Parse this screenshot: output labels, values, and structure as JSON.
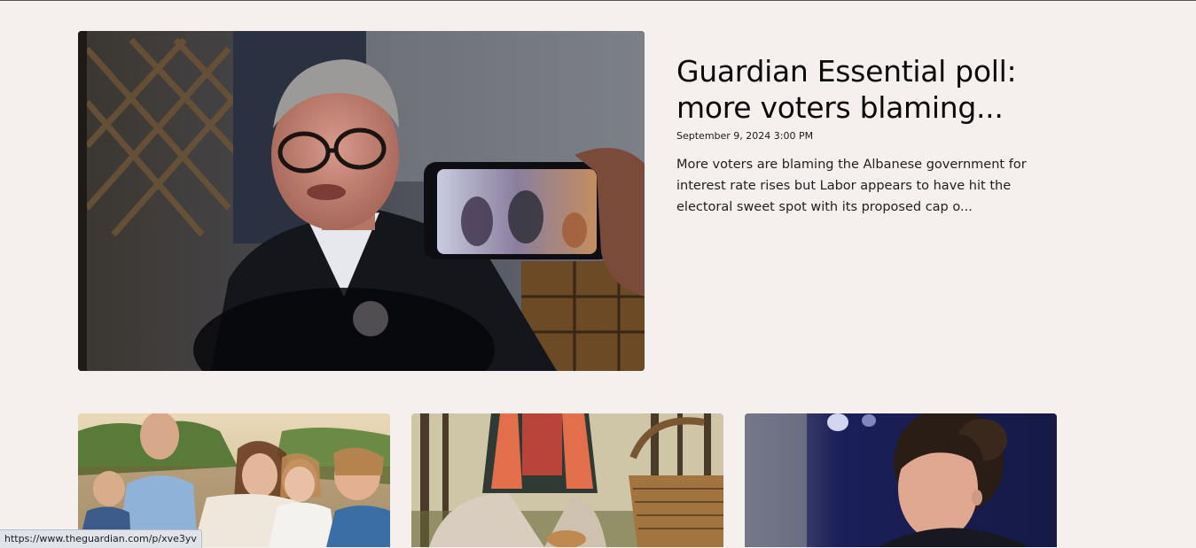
{
  "hero": {
    "title": "Guardian Essential poll: more voters blaming...",
    "date": "September 9, 2024 3:00 PM",
    "summary": "More voters are blaming the Albanese government for interest rate rises but Labor appears to have hit the electoral sweet spot with its proposed cap o...",
    "image_icon": "photo-prime-minister-speaking"
  },
  "cards": [
    {
      "image_icon": "photo-royal-family"
    },
    {
      "image_icon": "photo-foraging-basket"
    },
    {
      "image_icon": "photo-woman-portrait"
    }
  ],
  "status_bar": {
    "url": "https://www.theguardian.com/p/xve3yv"
  }
}
